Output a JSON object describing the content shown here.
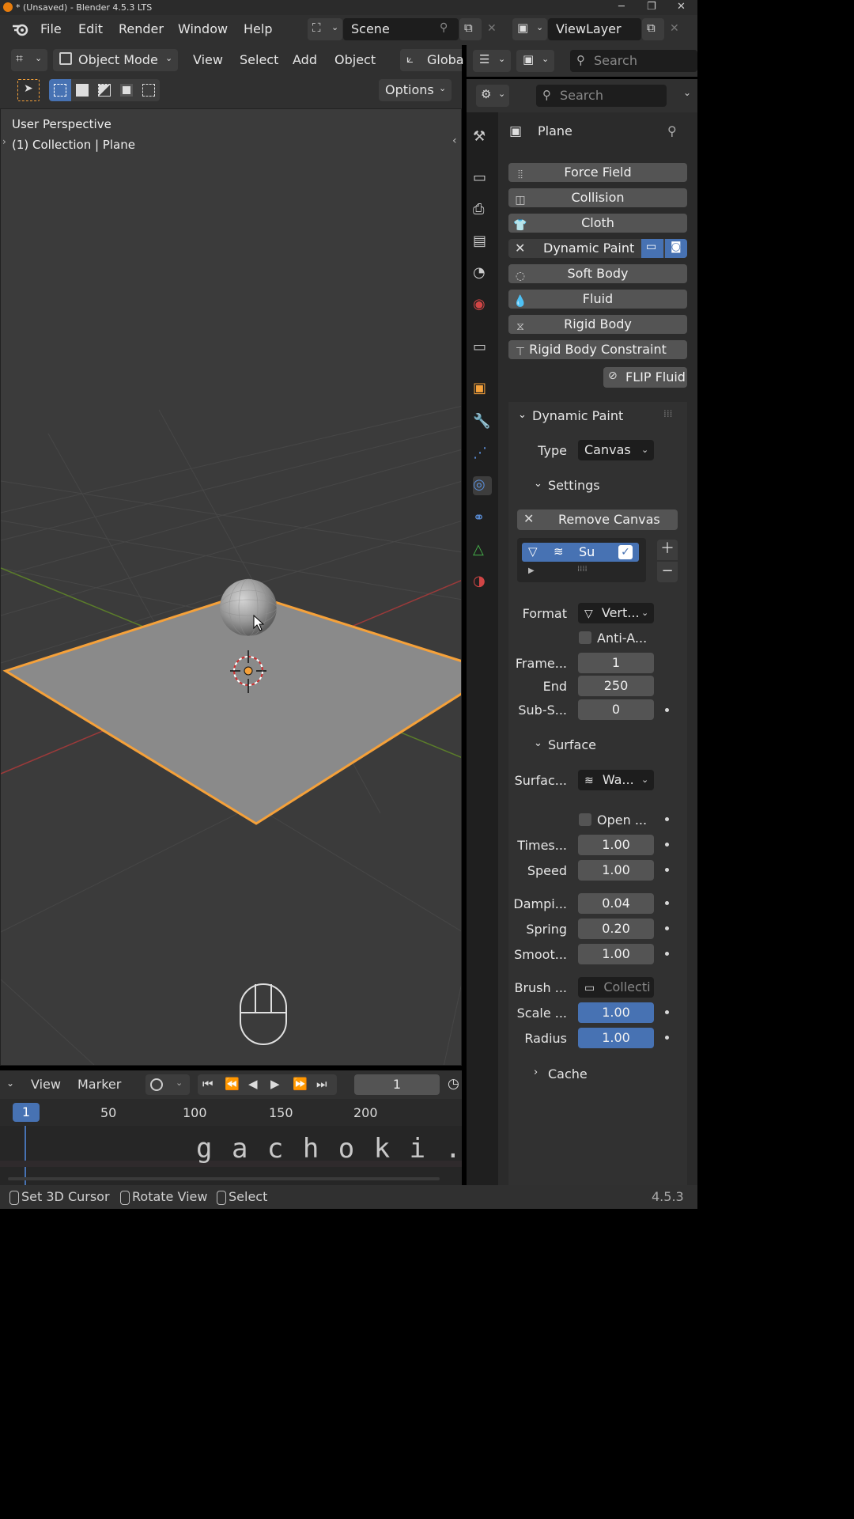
{
  "window": {
    "title": "* (Unsaved) - Blender 4.5.3 LTS"
  },
  "menu": [
    "File",
    "Edit",
    "Render",
    "Window",
    "Help"
  ],
  "scene": {
    "name": "Scene",
    "view_layer": "ViewLayer"
  },
  "viewport_header": {
    "mode": "Object Mode",
    "menus": [
      "View",
      "Select",
      "Add",
      "Object"
    ],
    "transform": "Globa",
    "options": "Options"
  },
  "viewport": {
    "perspective": "User Perspective",
    "collection": "(1) Collection | Plane"
  },
  "outliner_search_placeholder": "Search",
  "properties_search_placeholder": "Search",
  "properties": {
    "object_name": "Plane",
    "physics_buttons": [
      "Force Field",
      "Collision",
      "Cloth",
      "Dynamic Paint",
      "Soft Body",
      "Fluid",
      "Rigid Body",
      "Rigid Body Constraint"
    ],
    "flip_fluid": "FLIP Fluid",
    "dynamic_paint": {
      "header": "Dynamic Paint",
      "type_label": "Type",
      "type_value": "Canvas",
      "settings_label": "Settings",
      "remove_canvas": "Remove Canvas",
      "surface_item_name": "Su",
      "surface_item_checked": true,
      "format_label": "Format",
      "format_value": "Vert...",
      "anti_alias_label": "Anti-A...",
      "frame_start_label": "Frame...",
      "frame_start": "1",
      "end_label": "End",
      "end": "250",
      "substeps_label": "Sub-S...",
      "substeps": "0"
    },
    "surface": {
      "header": "Surface",
      "surface_type_label": "Surfac...",
      "surface_type_value": "Wa...",
      "open_borders_label": "Open ...",
      "timescale_label": "Times...",
      "timescale": "1.00",
      "speed_label": "Speed",
      "speed": "1.00",
      "damping_label": "Dampi...",
      "damping": "0.04",
      "spring_label": "Spring",
      "spring": "0.20",
      "smooth_label": "Smoot...",
      "smooth": "1.00",
      "brush_label": "Brush ...",
      "brush_value": "Collecti",
      "scale_label": "Scale ...",
      "scale": "1.00",
      "radius_label": "Radius",
      "radius": "1.00"
    },
    "cache_header": "Cache"
  },
  "timeline": {
    "menus": [
      "View",
      "Marker"
    ],
    "current_frame": "1",
    "ruler": [
      "1",
      "50",
      "100",
      "150",
      "200"
    ]
  },
  "status_bar": {
    "items": [
      "Set 3D Cursor",
      "Rotate View",
      "Select"
    ],
    "version": "4.5.3"
  },
  "watermark": "g a c h o k i . c o m",
  "colors": {
    "selection_orange": "#f5a13a",
    "accent_blue": "#4772b3",
    "x_axis_red": "#9b3a3a",
    "y_axis_green": "#5b7d2a"
  }
}
